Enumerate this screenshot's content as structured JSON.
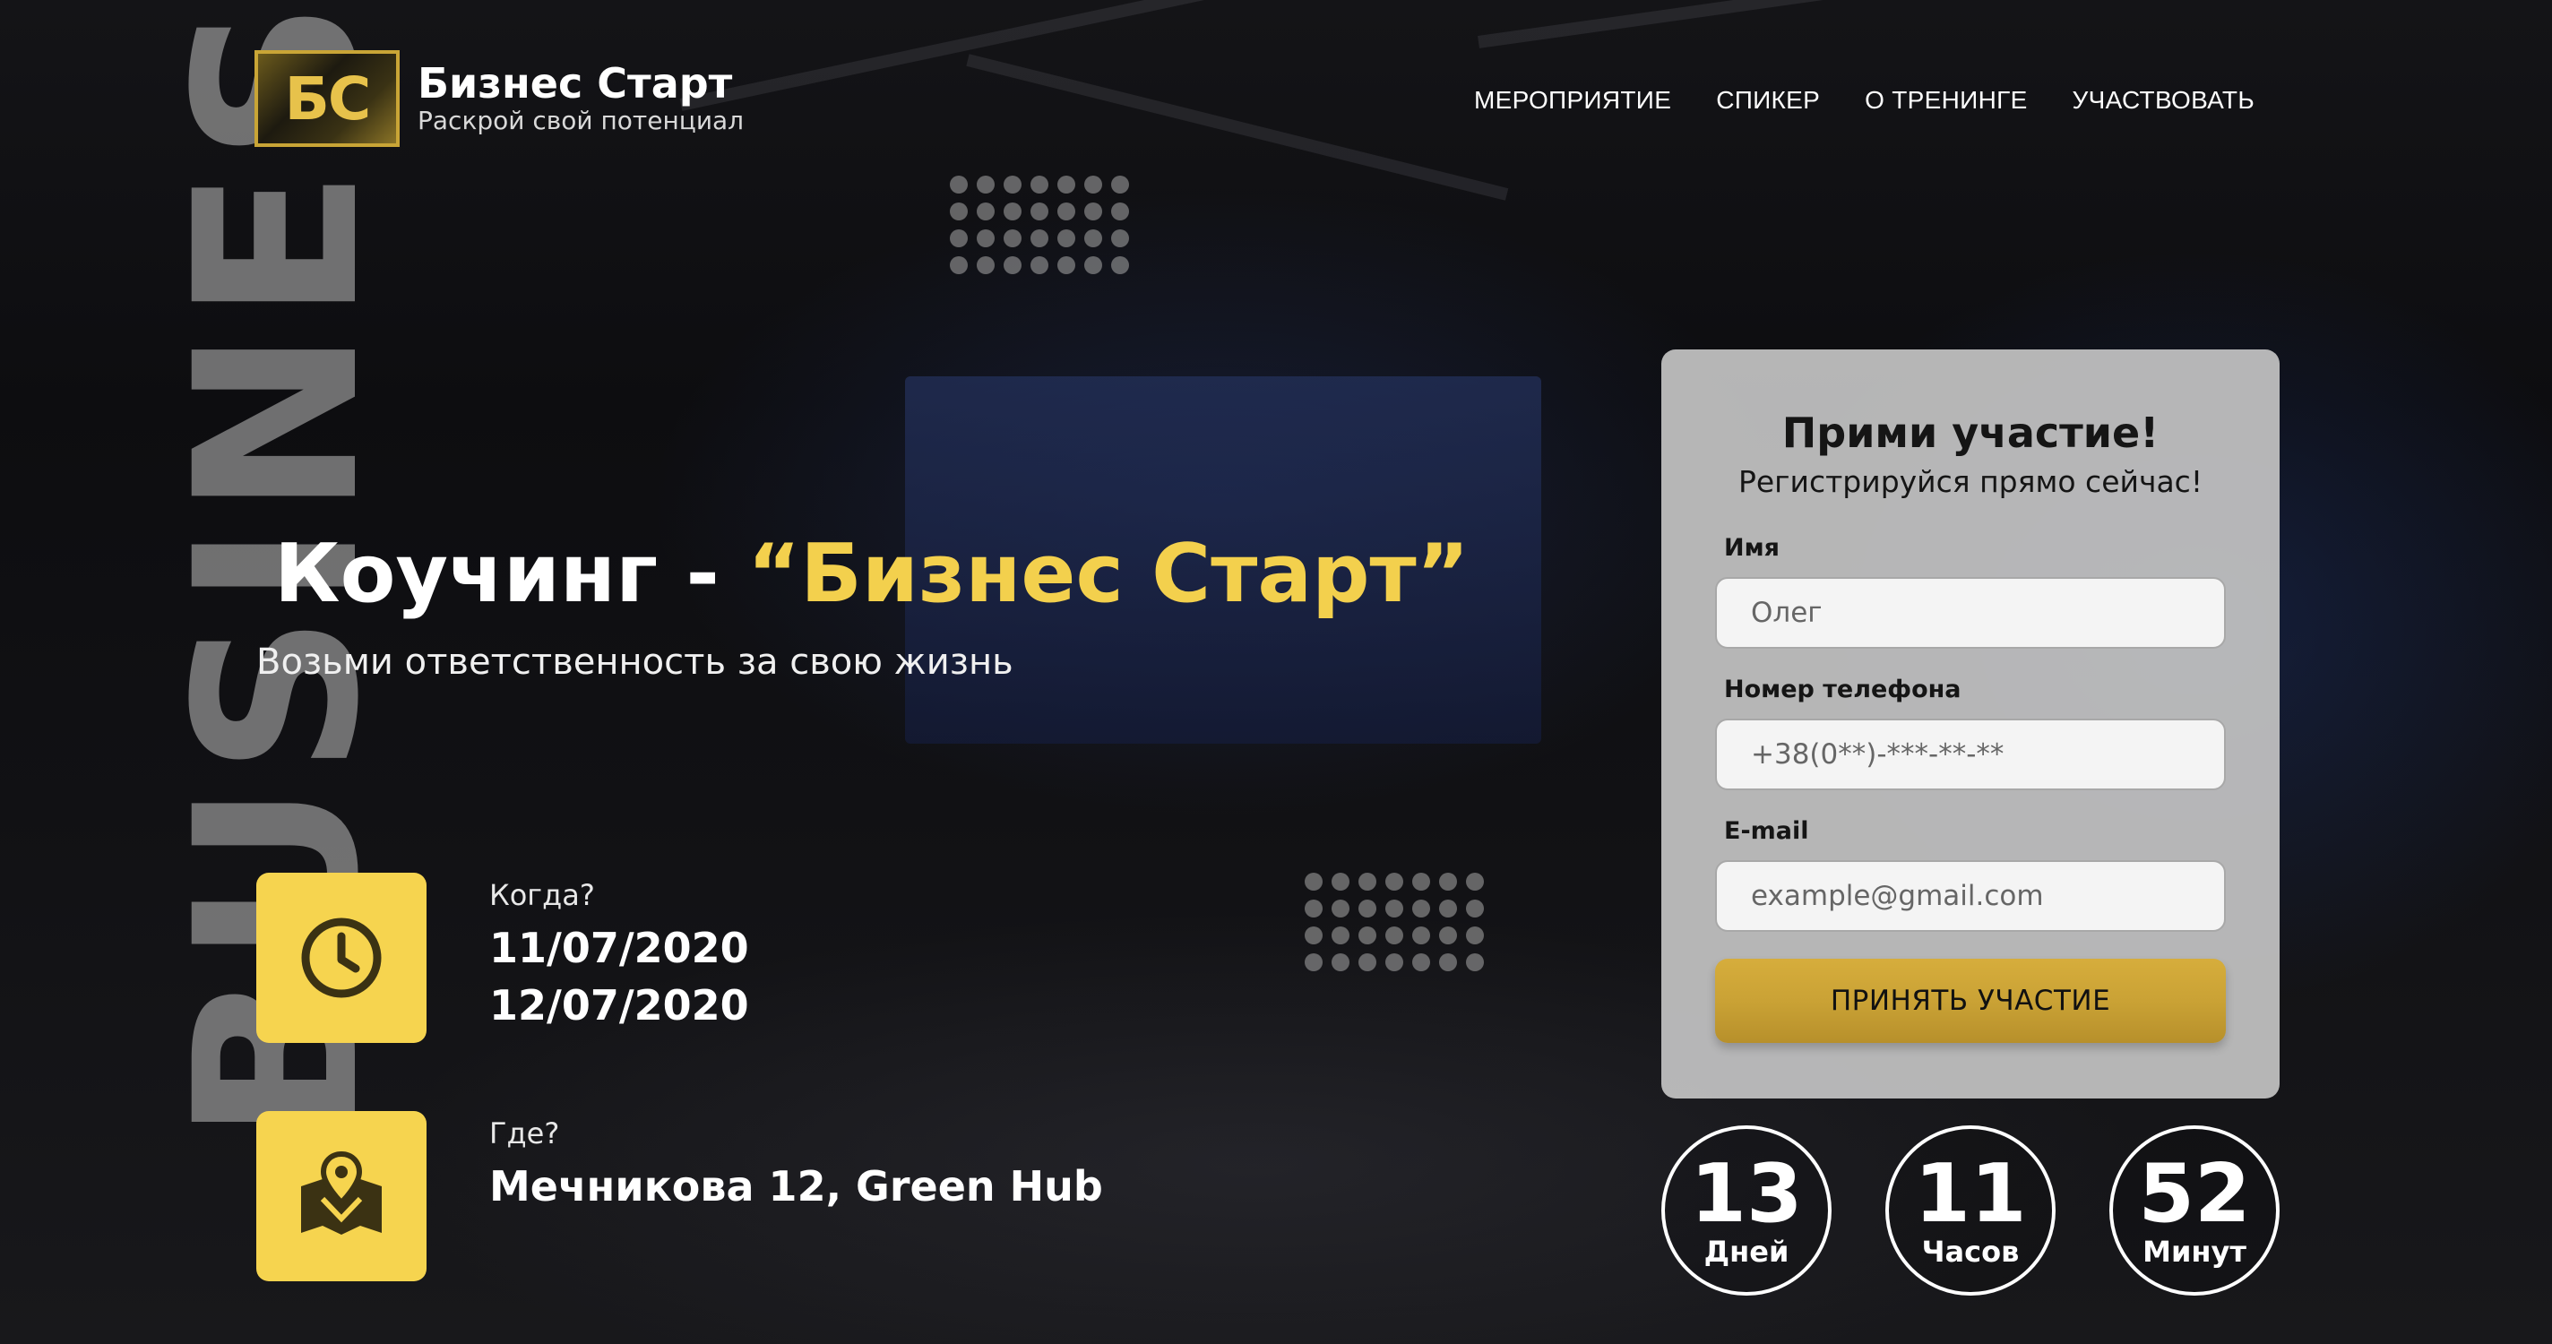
{
  "vertical_word": "BUSINESS",
  "logo": {
    "mark": "БС",
    "name": "Бизнес Старт",
    "tagline": "Раскрой свой потенциал"
  },
  "nav": {
    "items": [
      {
        "label": "МЕРОПРИЯТИЕ"
      },
      {
        "label": "СПИКЕР"
      },
      {
        "label": "О ТРЕНИНГЕ"
      },
      {
        "label": "УЧАСТВОВАТЬ"
      }
    ]
  },
  "hero": {
    "title_prefix": "Коучинг - ",
    "title_accent": "“Бизнес Старт”",
    "subtitle": "Возьми ответственность за свою жизнь"
  },
  "when": {
    "label": "Когда?",
    "dates": [
      "11/07/2020",
      "12/07/2020"
    ],
    "icon": "clock-icon"
  },
  "where": {
    "label": "Где?",
    "value": "Мечникова 12, Green Hub",
    "icon": "map-pin-icon"
  },
  "form": {
    "title": "Прими участие!",
    "subtitle": "Регистрируйся прямо сейчас!",
    "name_label": "Имя",
    "name_placeholder": "Олег",
    "phone_label": "Номер телефона",
    "phone_placeholder": "+38(0**)-***-**-**",
    "email_label": "E-mail",
    "email_placeholder": "example@gmail.com",
    "submit_label": "ПРИНЯТЬ УЧАСТИЕ"
  },
  "countdown": [
    {
      "value": "13",
      "unit": "Дней"
    },
    {
      "value": "11",
      "unit": "Часов"
    },
    {
      "value": "52",
      "unit": "Минут"
    }
  ],
  "colors": {
    "accent": "#f6d44f",
    "title_accent": "#f3d04d",
    "button": "#caa235",
    "form_bg": "#c3c3c3"
  }
}
